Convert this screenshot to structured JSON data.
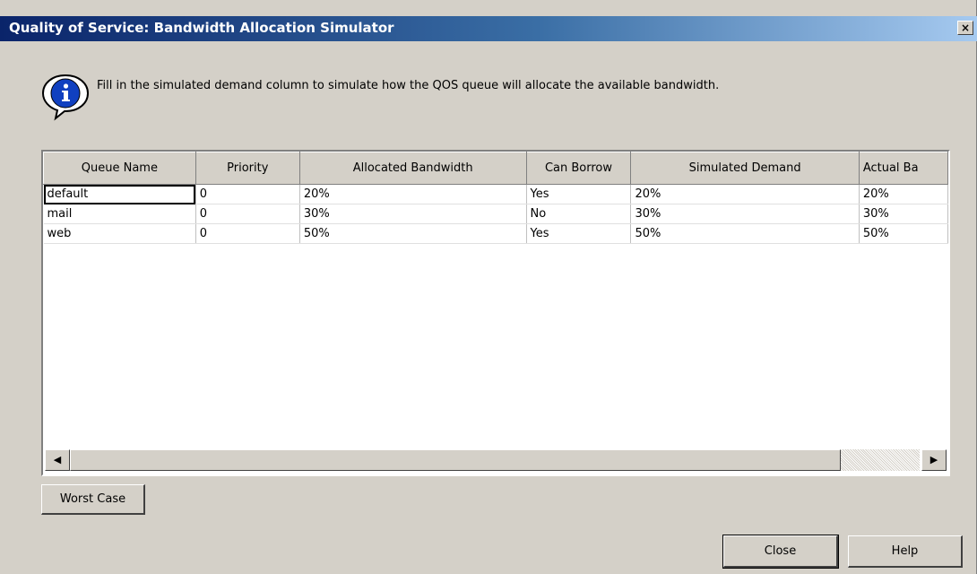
{
  "window": {
    "title": "Quality of Service: Bandwidth Allocation Simulator",
    "close_glyph": "×"
  },
  "info": {
    "icon": "info-icon",
    "message": "Fill in the simulated demand column to simulate how the QOS queue will allocate the available bandwidth."
  },
  "table": {
    "columns": [
      "Queue Name",
      "Priority",
      "Allocated Bandwidth",
      "Can Borrow",
      "Simulated Demand",
      "Actual Ba"
    ],
    "rows": [
      [
        "default",
        "0",
        "20%",
        "Yes",
        "20%",
        "20%"
      ],
      [
        "mail",
        "0",
        "30%",
        "No",
        "30%",
        "30%"
      ],
      [
        "web",
        "0",
        "50%",
        "Yes",
        "50%",
        "50%"
      ]
    ]
  },
  "scrollbar": {
    "left_arrow": "◀",
    "right_arrow": "▶"
  },
  "buttons": {
    "worst_case": "Worst Case",
    "close": "Close",
    "help": "Help"
  }
}
